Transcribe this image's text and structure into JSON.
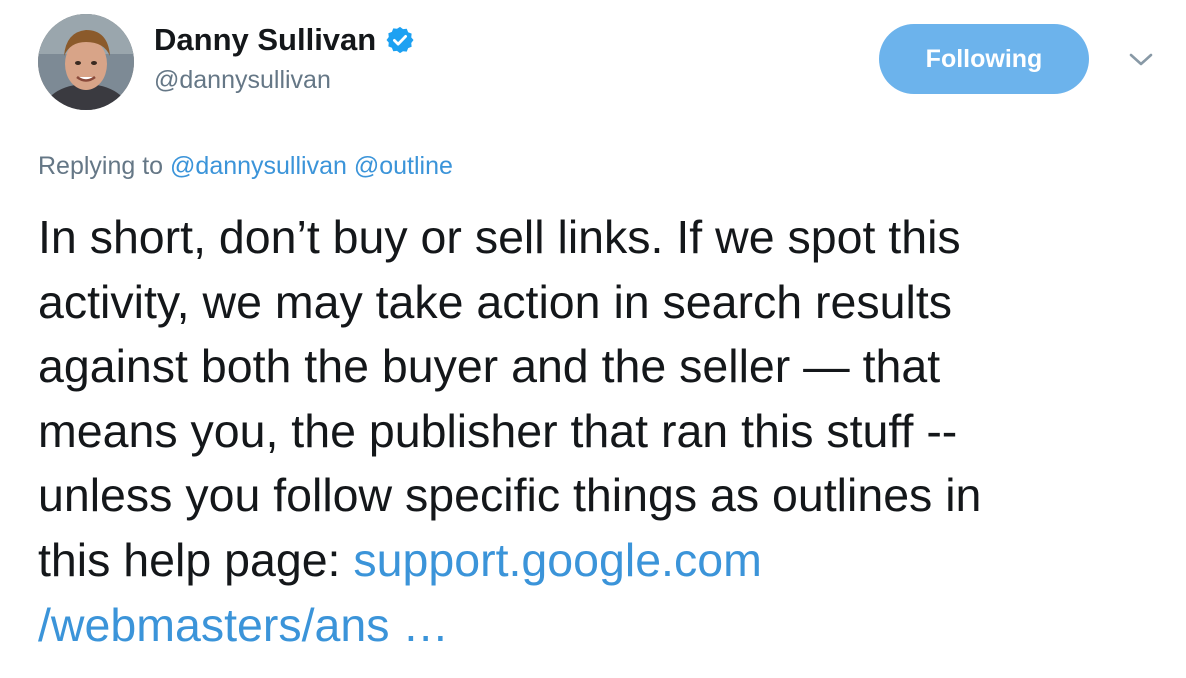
{
  "author": {
    "display_name": "Danny Sullivan",
    "handle": "@dannysullivan",
    "verified": true
  },
  "follow_button": {
    "label": "Following"
  },
  "menu": {
    "icon": "chevron-down-icon"
  },
  "reply_context": {
    "prefix": "Replying to",
    "mentions": [
      "@dannysullivan",
      "@outline"
    ]
  },
  "tweet": {
    "lines": [
      "In short, don’t buy or sell links. If we spot this",
      "activity, we may take action in search results",
      "against both the buyer and the seller — that",
      "means you, the publisher that ran this stuff --",
      "unless you follow specific things as outlines in",
      "this help page: "
    ],
    "link_part1": "support.google.com",
    "link_part2": "/webmasters/ans …"
  },
  "colors": {
    "link": "#3b94d9",
    "button": "#6cb3ec",
    "verified": "#1da1f2",
    "secondary_text": "#657786",
    "primary_text": "#14171a"
  }
}
